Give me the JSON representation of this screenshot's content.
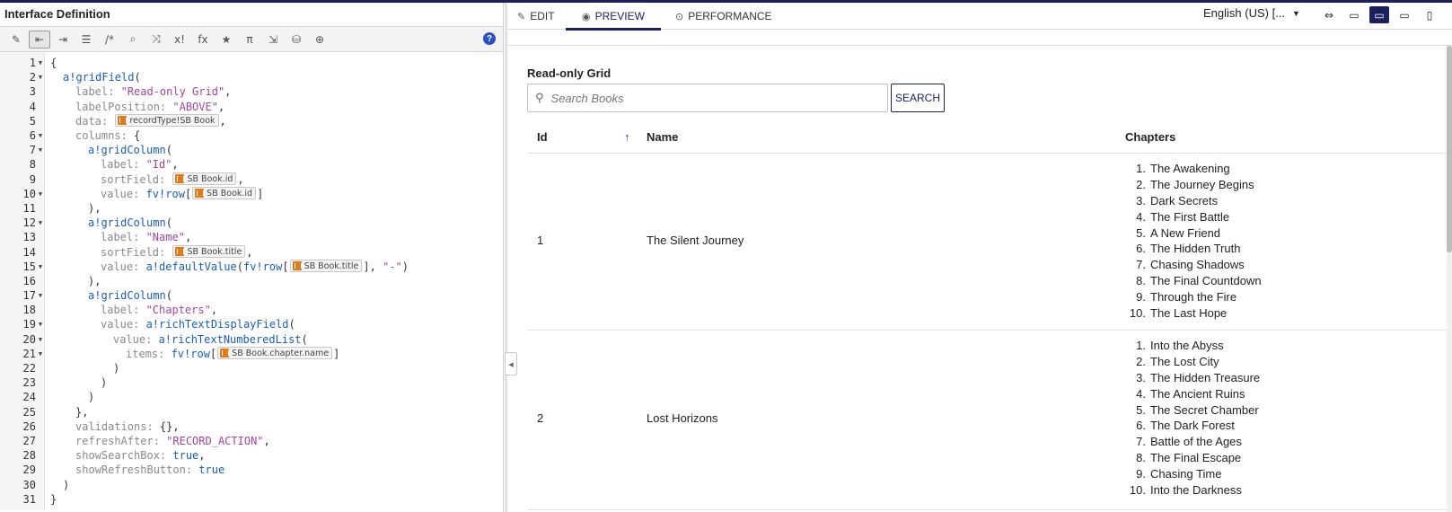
{
  "editor": {
    "title": "Interface Definition",
    "toolbar": [
      {
        "name": "magic-wand-icon",
        "glyph": "✎"
      },
      {
        "name": "outdent-icon",
        "glyph": "⇤",
        "active": true
      },
      {
        "name": "indent-icon",
        "glyph": "⇥"
      },
      {
        "name": "list-icon",
        "glyph": "☰"
      },
      {
        "name": "comment-icon",
        "glyph": "/*"
      },
      {
        "name": "search-icon",
        "glyph": "⌕"
      },
      {
        "name": "shuffle-icon",
        "glyph": "⤨"
      },
      {
        "name": "clear-icon",
        "glyph": "x!"
      },
      {
        "name": "function-icon",
        "glyph": "fx"
      },
      {
        "name": "star-icon",
        "glyph": "★"
      },
      {
        "name": "pi-icon",
        "glyph": "π"
      },
      {
        "name": "export-icon",
        "glyph": "⇲"
      },
      {
        "name": "database-search-icon",
        "glyph": "⛁"
      },
      {
        "name": "globe-icon",
        "glyph": "⊕"
      }
    ],
    "help": "?",
    "lines": [
      {
        "n": "1",
        "fold": true,
        "i": 0,
        "t": [
          [
            "p",
            "{"
          ]
        ]
      },
      {
        "n": "2",
        "fold": true,
        "i": 1,
        "t": [
          [
            "k",
            "a!gridField"
          ],
          [
            "p",
            "("
          ]
        ]
      },
      {
        "n": "3",
        "i": 2,
        "t": [
          [
            "r",
            "label: "
          ],
          [
            "s",
            "\"Read-only Grid\""
          ],
          [
            "p",
            ","
          ]
        ]
      },
      {
        "n": "4",
        "i": 2,
        "t": [
          [
            "r",
            "labelPosition: "
          ],
          [
            "s",
            "\"ABOVE\""
          ],
          [
            "p",
            ","
          ]
        ]
      },
      {
        "n": "5",
        "i": 2,
        "t": [
          [
            "r",
            "data: "
          ],
          [
            "c",
            "recordType!SB Book"
          ],
          [
            "p",
            ","
          ]
        ]
      },
      {
        "n": "6",
        "fold": true,
        "i": 2,
        "t": [
          [
            "r",
            "columns: "
          ],
          [
            "p",
            "{"
          ]
        ]
      },
      {
        "n": "7",
        "fold": true,
        "i": 3,
        "t": [
          [
            "k",
            "a!gridColumn"
          ],
          [
            "p",
            "("
          ]
        ]
      },
      {
        "n": "8",
        "i": 4,
        "t": [
          [
            "r",
            "label: "
          ],
          [
            "s",
            "\"Id\""
          ],
          [
            "p",
            ","
          ]
        ]
      },
      {
        "n": "9",
        "i": 4,
        "t": [
          [
            "r",
            "sortField: "
          ],
          [
            "c",
            "SB Book.id"
          ],
          [
            "p",
            ","
          ]
        ]
      },
      {
        "n": "10",
        "fold": true,
        "i": 4,
        "t": [
          [
            "r",
            "value: "
          ],
          [
            "k",
            "fv!row"
          ],
          [
            "p",
            "["
          ],
          [
            "c",
            "SB Book.id"
          ],
          [
            "p",
            "]"
          ]
        ]
      },
      {
        "n": "11",
        "i": 3,
        "t": [
          [
            "p",
            "),"
          ]
        ]
      },
      {
        "n": "12",
        "fold": true,
        "i": 3,
        "t": [
          [
            "k",
            "a!gridColumn"
          ],
          [
            "p",
            "("
          ]
        ]
      },
      {
        "n": "13",
        "i": 4,
        "t": [
          [
            "r",
            "label: "
          ],
          [
            "s",
            "\"Name\""
          ],
          [
            "p",
            ","
          ]
        ]
      },
      {
        "n": "14",
        "i": 4,
        "t": [
          [
            "r",
            "sortField: "
          ],
          [
            "c",
            "SB Book.title"
          ],
          [
            "p",
            ","
          ]
        ]
      },
      {
        "n": "15",
        "fold": true,
        "i": 4,
        "t": [
          [
            "r",
            "value: "
          ],
          [
            "k",
            "a!defaultValue"
          ],
          [
            "p",
            "("
          ],
          [
            "k",
            "fv!row"
          ],
          [
            "p",
            "["
          ],
          [
            "c",
            "SB Book.title"
          ],
          [
            "p",
            "], "
          ],
          [
            "s",
            "\"-\""
          ],
          [
            "p",
            ")"
          ]
        ]
      },
      {
        "n": "16",
        "i": 3,
        "t": [
          [
            "p",
            "),"
          ]
        ]
      },
      {
        "n": "17",
        "fold": true,
        "i": 3,
        "t": [
          [
            "k",
            "a!gridColumn"
          ],
          [
            "p",
            "("
          ]
        ]
      },
      {
        "n": "18",
        "i": 4,
        "t": [
          [
            "r",
            "label: "
          ],
          [
            "s",
            "\"Chapters\""
          ],
          [
            "p",
            ","
          ]
        ]
      },
      {
        "n": "19",
        "fold": true,
        "i": 4,
        "t": [
          [
            "r",
            "value: "
          ],
          [
            "k",
            "a!richTextDisplayField"
          ],
          [
            "p",
            "("
          ]
        ]
      },
      {
        "n": "20",
        "fold": true,
        "i": 5,
        "t": [
          [
            "r",
            "value: "
          ],
          [
            "k",
            "a!richTextNumberedList"
          ],
          [
            "p",
            "("
          ]
        ]
      },
      {
        "n": "21",
        "fold": true,
        "i": 6,
        "t": [
          [
            "r",
            "items: "
          ],
          [
            "k",
            "fv!row"
          ],
          [
            "p",
            "["
          ],
          [
            "c",
            "SB Book.chapter.name"
          ],
          [
            "p",
            "]"
          ]
        ]
      },
      {
        "n": "22",
        "i": 5,
        "t": [
          [
            "p",
            ")"
          ]
        ]
      },
      {
        "n": "23",
        "i": 4,
        "t": [
          [
            "p",
            ")"
          ]
        ]
      },
      {
        "n": "24",
        "i": 3,
        "t": [
          [
            "p",
            ")"
          ]
        ]
      },
      {
        "n": "25",
        "i": 2,
        "t": [
          [
            "p",
            "},"
          ]
        ]
      },
      {
        "n": "26",
        "i": 2,
        "t": [
          [
            "r",
            "validations: "
          ],
          [
            "p",
            "{},"
          ]
        ]
      },
      {
        "n": "27",
        "i": 2,
        "t": [
          [
            "r",
            "refreshAfter: "
          ],
          [
            "s",
            "\"RECORD_ACTION\""
          ],
          [
            "p",
            ","
          ]
        ]
      },
      {
        "n": "28",
        "i": 2,
        "t": [
          [
            "r",
            "showSearchBox: "
          ],
          [
            "b",
            "true"
          ],
          [
            "p",
            ","
          ]
        ]
      },
      {
        "n": "29",
        "i": 2,
        "t": [
          [
            "r",
            "showRefreshButton: "
          ],
          [
            "b",
            "true"
          ]
        ]
      },
      {
        "n": "30",
        "i": 1,
        "t": [
          [
            "p",
            ")"
          ]
        ]
      },
      {
        "n": "31",
        "i": 0,
        "t": [
          [
            "p",
            "}"
          ]
        ]
      }
    ]
  },
  "tabs": [
    {
      "label": "EDIT",
      "icon": "✎",
      "name": "tab-edit",
      "active": false
    },
    {
      "label": "PREVIEW",
      "icon": "◉",
      "name": "tab-preview",
      "active": true
    },
    {
      "label": "PERFORMANCE",
      "icon": "⊙",
      "name": "tab-performance",
      "active": false
    }
  ],
  "locale": {
    "value": "English (US) [...",
    "caret": "▼"
  },
  "devices": [
    {
      "name": "fit-width-icon",
      "glyph": "⇔",
      "active": false
    },
    {
      "name": "desktop-icon",
      "glyph": "▭",
      "active": false
    },
    {
      "name": "monitor-icon",
      "glyph": "▭",
      "active": true
    },
    {
      "name": "tablet-landscape-icon",
      "glyph": "▭",
      "active": false
    },
    {
      "name": "tablet-portrait-icon",
      "glyph": "▯",
      "active": false
    }
  ],
  "collapse_icon": "◂",
  "preview": {
    "grid_label": "Read-only Grid",
    "search": {
      "placeholder": "Search Books",
      "button": "SEARCH",
      "icon": "⚲"
    },
    "columns": {
      "id": "Id",
      "name": "Name",
      "chapters": "Chapters",
      "sort_icon": "↑"
    },
    "rows": [
      {
        "id": "1",
        "name": "The Silent Journey",
        "chapters": [
          "The Awakening",
          "The Journey Begins",
          "Dark Secrets",
          "The First Battle",
          "A New Friend",
          "The Hidden Truth",
          "Chasing Shadows",
          "The Final Countdown",
          "Through the Fire",
          "The Last Hope"
        ]
      },
      {
        "id": "2",
        "name": "Lost Horizons",
        "chapters": [
          "Into the Abyss",
          "The Lost City",
          "The Hidden Treasure",
          "The Ancient Ruins",
          "The Secret Chamber",
          "The Dark Forest",
          "Battle of the Ages",
          "The Final Escape",
          "Chasing Time",
          "Into the Darkness"
        ]
      }
    ]
  },
  "colors": {
    "accent": "#1c1f5e",
    "keyword": "#1a5fb4",
    "string": "#a0469b",
    "chip_icon": "#e07b1a"
  }
}
